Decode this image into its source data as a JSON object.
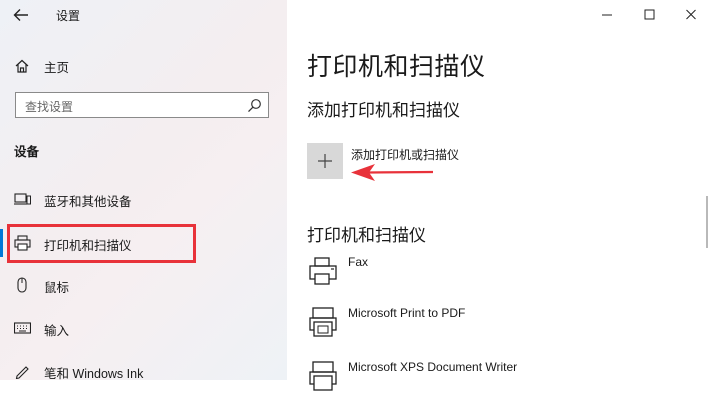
{
  "window": {
    "title": "设置"
  },
  "sidebar": {
    "home_label": "主页",
    "search_placeholder": "查找设置",
    "section_title": "设备",
    "items": [
      {
        "label": "蓝牙和其他设备",
        "icon": "bluetooth-devices-icon"
      },
      {
        "label": "打印机和扫描仪",
        "icon": "printer-icon",
        "selected": true
      },
      {
        "label": "鼠标",
        "icon": "mouse-icon"
      },
      {
        "label": "输入",
        "icon": "keyboard-icon"
      },
      {
        "label": "笔和 Windows Ink",
        "icon": "pen-icon"
      }
    ]
  },
  "main": {
    "title": "打印机和扫描仪",
    "add_section_title": "添加打印机和扫描仪",
    "add_button_label": "添加打印机或扫描仪",
    "list_section_title": "打印机和扫描仪",
    "devices": [
      {
        "name": "Fax",
        "icon": "fax-icon"
      },
      {
        "name": "Microsoft Print to PDF",
        "icon": "printer-icon"
      },
      {
        "name": "Microsoft XPS Document Writer",
        "icon": "printer-icon"
      }
    ]
  },
  "colors": {
    "accent": "#0078d7",
    "highlight_box": "#e8323a",
    "arrow": "#e8323a",
    "add_tile": "#d8d8d8"
  }
}
